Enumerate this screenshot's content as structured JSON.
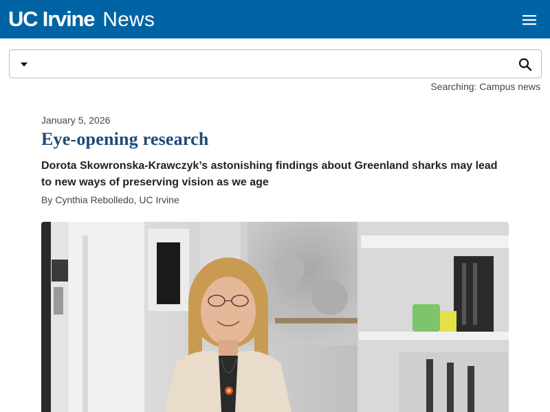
{
  "header": {
    "brand_primary": "UC Irvine",
    "brand_secondary": "News",
    "background_color": "#0064a4",
    "menu_icon": "hamburger-menu-icon"
  },
  "search": {
    "placeholder": "",
    "value": "",
    "dropdown_icon": "caret-down-icon",
    "submit_icon": "search-icon",
    "scope_text": "Searching: Campus news"
  },
  "article": {
    "date": "January 5, 2026",
    "title": "Eye-opening research",
    "subtitle": "Dorota Skowronska-Krawczyk’s astonishing findings about Greenland sharks may lead to new ways of preserving vision as we age",
    "byline": "By Cynthia Rebolledo, UC Irvine",
    "title_color": "#1b4a78"
  }
}
